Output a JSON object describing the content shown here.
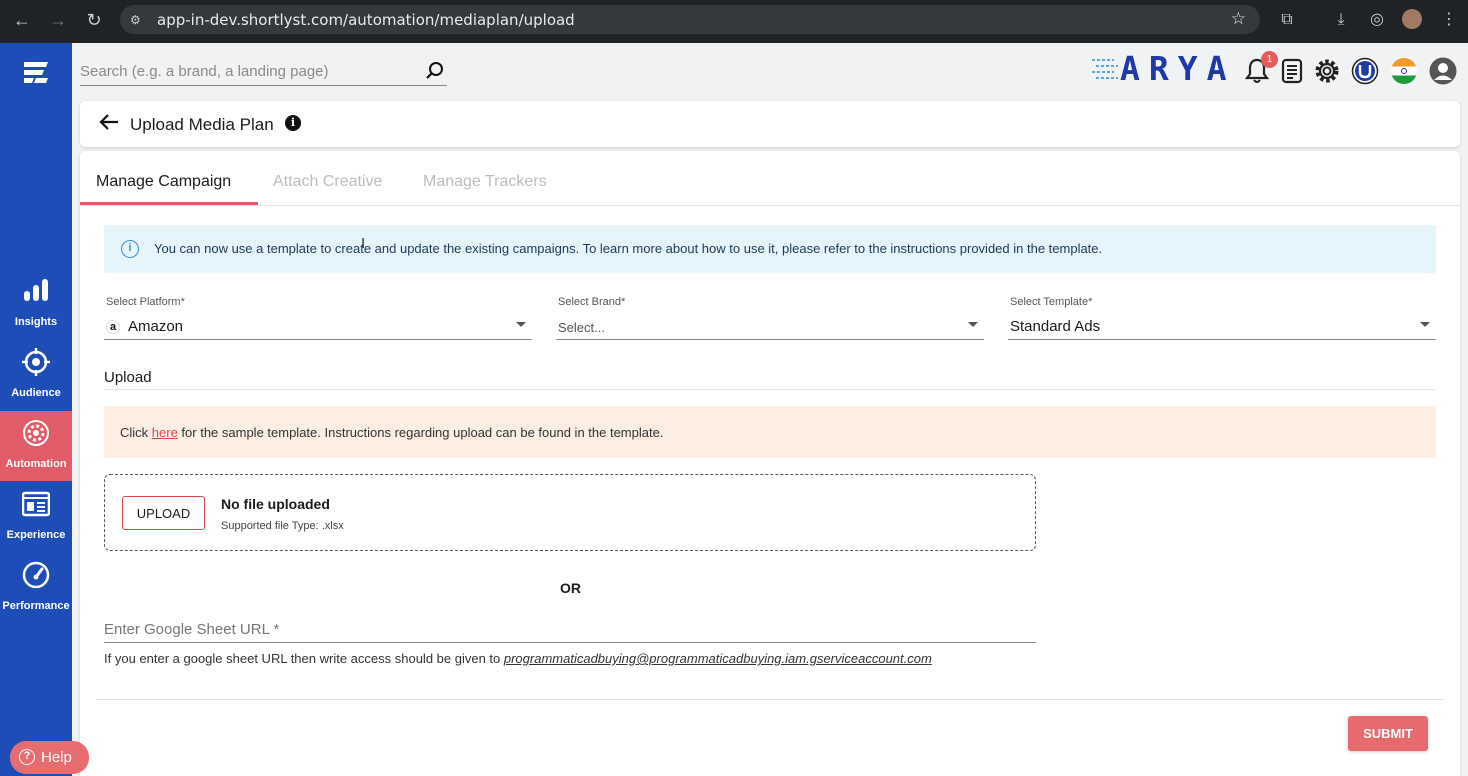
{
  "browser": {
    "url": "app-in-dev.shortlyst.com/automation/mediaplan/upload"
  },
  "sidebar": {
    "items": [
      {
        "label": "Insights",
        "icon": "bar-chart-icon",
        "active": false
      },
      {
        "label": "Audience",
        "icon": "target-icon",
        "active": false
      },
      {
        "label": "Automation",
        "icon": "gear-icon",
        "active": true
      },
      {
        "label": "Experience",
        "icon": "newspaper-icon",
        "active": false
      },
      {
        "label": "Performance",
        "icon": "speedometer-icon",
        "active": false
      }
    ]
  },
  "topbar": {
    "search_placeholder": "Search (e.g. a brand, a landing page)",
    "logo_text": "ARYA",
    "notification_count": "1"
  },
  "header": {
    "title": "Upload Media Plan"
  },
  "tabs": [
    {
      "label": "Manage Campaign",
      "active": true
    },
    {
      "label": "Attach Creative",
      "active": false
    },
    {
      "label": "Manage Trackers",
      "active": false
    }
  ],
  "info_message": "You can now use a template to create and update the existing campaigns. To learn more about how to use it, please refer to the instructions provided in the template.",
  "fields": {
    "platform": {
      "label": "Select Platform*",
      "value": "Amazon"
    },
    "brand": {
      "label": "Select Brand*",
      "placeholder": "Select..."
    },
    "template": {
      "label": "Select Template*",
      "value": "Standard Ads"
    }
  },
  "upload": {
    "heading": "Upload",
    "notice_prefix": "Click ",
    "notice_link": "here",
    "notice_suffix": " for the sample template. Instructions regarding upload can be found in the template.",
    "button_label": "UPLOAD",
    "status_title": "No file uploaded",
    "supported_types": "Supported file Type: .xlsx",
    "or_label": "OR",
    "sheet_placeholder": "Enter Google Sheet URL *",
    "sheet_help_prefix": "If you enter a google sheet URL then write access should be given to ",
    "sheet_help_email": "programmaticadbuying@programmaticadbuying.iam.gserviceaccount.com"
  },
  "submit_label": "SUBMIT",
  "help_label": "Help",
  "colors": {
    "sidebar": "#1f4db8",
    "accent": "#e05c68",
    "info_bg": "#e6f4fb",
    "notice_bg": "#fdeee4"
  }
}
